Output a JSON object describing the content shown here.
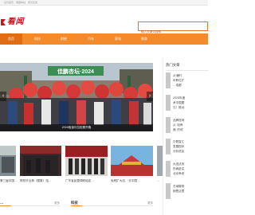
{
  "topbar": {
    "text": "…设为首页　收藏本站　意见反馈"
  },
  "header": {
    "logo_text": "看闻",
    "search_placeholder": "输入关键词搜索…"
  },
  "nav": {
    "items": [
      {
        "label": "首页"
      },
      {
        "label": "科技"
      },
      {
        "label": "财经"
      },
      {
        "label": "汽车"
      },
      {
        "label": "家电"
      },
      {
        "label": "教育"
      }
    ]
  },
  "carousel": {
    "banner_text": "佳鹏杏坛·2024",
    "caption": "2024临淄马拉松赛开跑",
    "prev": "‹",
    "next": "›"
  },
  "thumbs": [
    {
      "caption": "第三届中国…"
    },
    {
      "caption": "院校毕业典（图集）结…"
    },
    {
      "caption": "广东省民盟调研组走…"
    },
    {
      "caption": "免税扩大店，'去中国'…"
    },
    {
      "caption": "…"
    }
  ],
  "sections": [
    {
      "title": "…",
      "more": "更多"
    },
    {
      "title": "科技",
      "more": "更多"
    }
  ],
  "sidebar": {
    "title": "热门文章",
    "items": [
      {
        "text": "从'横行\n年职位扩\n…成都"
      },
      {
        "text": "2025年度\n术中国图\n汉）推动"
      },
      {
        "text": "品牌咨询\n从 '培养\n面' 的领"
      },
      {
        "text": "中数智汇\n发展现状\n分析低反"
      },
      {
        "text": "大连法务\n伤病赶买\n北京养老"
      },
      {
        "text": "艺域展带\n销售店里"
      }
    ]
  }
}
